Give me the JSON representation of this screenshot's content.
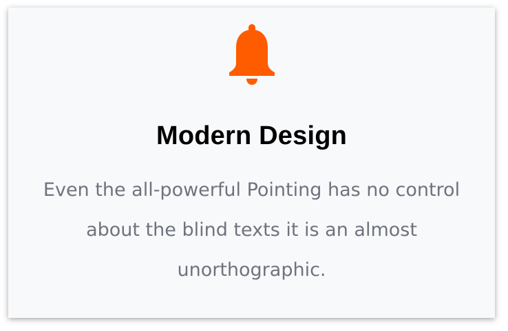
{
  "card": {
    "icon": "bell-icon",
    "icon_color": "#ff5c00",
    "title": "Modern Design",
    "description_lines": [
      "Even the all-powerful Pointing has no control",
      "about the blind texts it is an almost",
      "unorthographic."
    ]
  }
}
